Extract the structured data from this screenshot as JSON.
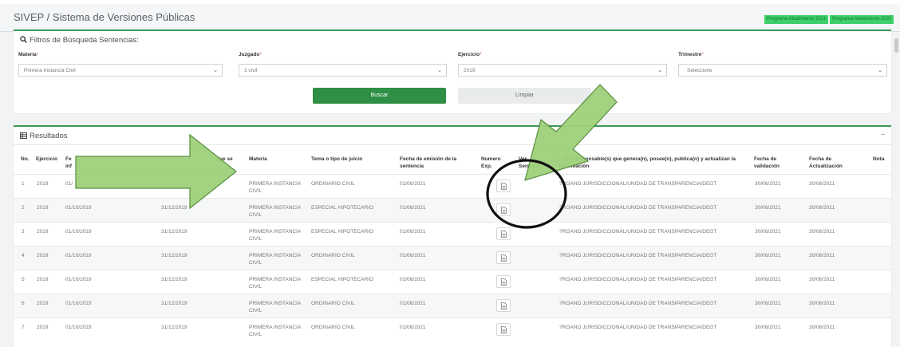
{
  "header": {
    "title": "SIVEP / Sistema de Versiones Públicas",
    "badges": [
      "Programa Abatimiento 2021",
      "Programa Abatimiento 2022"
    ]
  },
  "filters": {
    "heading": "Filtros de Búsqueda Sentencias:",
    "materia": {
      "label": "Materia",
      "value": "Primera Instancia Civil"
    },
    "juzgado": {
      "label": "Juzgado",
      "value": "1 civil"
    },
    "ejercicio": {
      "label": "Ejercicio",
      "value": "2019"
    },
    "trimestre": {
      "label": "Trimestre",
      "value": "Seleccione"
    },
    "buscar": "Buscar",
    "limpiar": "Limpiar"
  },
  "results": {
    "heading": "Resultados",
    "collapse": "–",
    "columns": {
      "no": "No.",
      "ejercicio": "Ejercicio",
      "fecha_inicio": "Fe\ninf",
      "fecha_fin": "que se",
      "materia": "Materia",
      "tema": "Tema o tipo de juicio",
      "fecha_emision": "Fecha de emisión de la\nsentencia",
      "numero": "Numero\nExp.",
      "ver": "Ver\nSentenc",
      "area": "...a(s) responsable(s) que genera(n), posee(n), publica(n) y actualizan la\ninformación",
      "fecha_validacion": "Fecha de\nvalidación",
      "fecha_actualizacion": "Fecha de\nActualización",
      "nota": "Nota"
    },
    "rows": [
      {
        "no": "1",
        "ejercicio": "2019",
        "fecha_inicio": "01/",
        "fecha_fin": "",
        "materia": "PRIMERA INSTANCIA\nCIVIL",
        "tema": "ORDINARIO CIVIL",
        "fecha_emision": "01/06/2021",
        "area": "?RGANO JURISDICCIONAL/UNIDAD DE TRANSPARENCIA/DEGT",
        "fecha_validacion": "30/06/2021",
        "fecha_actualizacion": "30/06/2021"
      },
      {
        "no": "2",
        "ejercicio": "2019",
        "fecha_inicio": "01/10/2019",
        "fecha_fin": "31/12/2019",
        "materia": "PRIMERA INSTANCIA\nCIVIL",
        "tema": "ESPECIAL HIPOTECARIO",
        "fecha_emision": "01/06/2021",
        "area": "?RGANO JURISDICCIONAL/UNIDAD DE TRANSPARENCIA/DEGT",
        "fecha_validacion": "30/06/2021",
        "fecha_actualizacion": "30/06/2021"
      },
      {
        "no": "3",
        "ejercicio": "2019",
        "fecha_inicio": "01/10/2019",
        "fecha_fin": "31/12/2019",
        "materia": "PRIMERA INSTANCIA\nCIVIL",
        "tema": "ESPECIAL HIPOTECARIO",
        "fecha_emision": "01/06/2021",
        "area": "?RGANO JURISDICCIONAL/UNIDAD DE TRANSPARENCIA/DEGT",
        "fecha_validacion": "30/06/2021",
        "fecha_actualizacion": "30/06/2021"
      },
      {
        "no": "4",
        "ejercicio": "2019",
        "fecha_inicio": "01/10/2019",
        "fecha_fin": "31/12/2019",
        "materia": "PRIMERA INSTANCIA\nCIVIL",
        "tema": "ORDINARIO CIVIL",
        "fecha_emision": "01/06/2021",
        "area": "?RGANO JURISDICCIONAL/UNIDAD DE TRANSPARENCIA/DEGT",
        "fecha_validacion": "30/06/2021",
        "fecha_actualizacion": "30/06/2021"
      },
      {
        "no": "5",
        "ejercicio": "2019",
        "fecha_inicio": "01/10/2019",
        "fecha_fin": "31/12/2019",
        "materia": "PRIMERA INSTANCIA\nCIVIL",
        "tema": "ESPECIAL HIPOTECARIO",
        "fecha_emision": "01/06/2021",
        "area": "?RGANO JURISDICCIONAL/UNIDAD DE TRANSPARENCIA/DEGT",
        "fecha_validacion": "30/06/2021",
        "fecha_actualizacion": "30/06/2021"
      },
      {
        "no": "6",
        "ejercicio": "2019",
        "fecha_inicio": "01/10/2019",
        "fecha_fin": "31/12/2019",
        "materia": "PRIMERA INSTANCIA\nCIVIL",
        "tema": "ORDINARIO CIVIL",
        "fecha_emision": "01/06/2021",
        "area": "?RGANO JURISDICCIONAL/UNIDAD DE TRANSPARENCIA/DEGT",
        "fecha_validacion": "30/06/2021",
        "fecha_actualizacion": "30/06/2021"
      },
      {
        "no": "7",
        "ejercicio": "2019",
        "fecha_inicio": "01/10/2019",
        "fecha_fin": "31/12/2019",
        "materia": "PRIMERA INSTANCIA\nCIVIL",
        "tema": "ORDINARIO CIVIL",
        "fecha_emision": "01/06/2021",
        "area": "?RGANO JURISDICCIONAL/UNIDAD DE TRANSPARENCIA/DEGT",
        "fecha_validacion": "30/06/2021",
        "fecha_actualizacion": "30/06/2021"
      }
    ]
  },
  "icons": {
    "search": "search-icon",
    "table": "table-icon",
    "document": "document-icon",
    "chevron": "chevron-down-icon"
  },
  "colors": {
    "accent": "#3b9a57",
    "buscar": "#2f8f45",
    "badge": "#3dd068",
    "arrow_fill": "#9fd17a",
    "arrow_stroke": "#4f8a36",
    "circle": "#111111"
  }
}
